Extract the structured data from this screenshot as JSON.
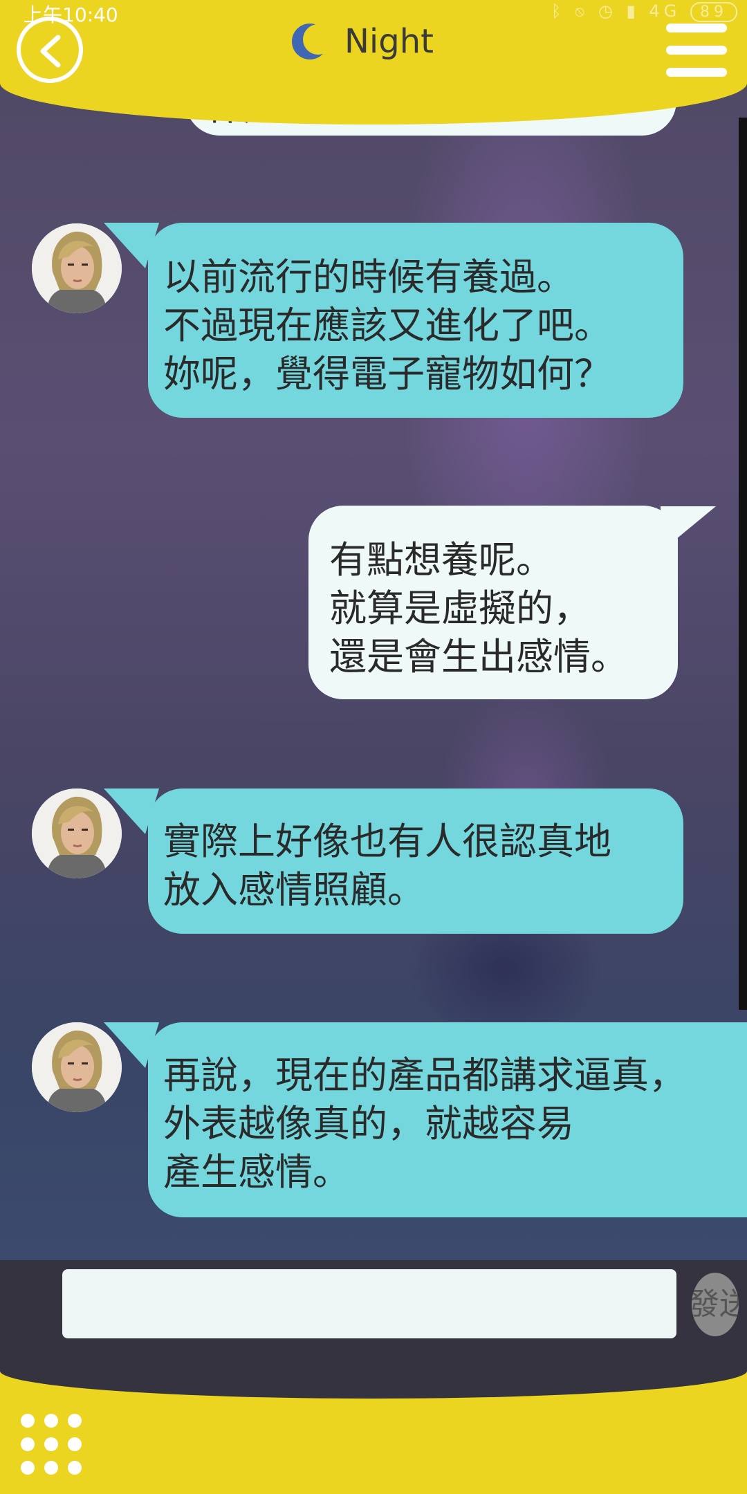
{
  "status_bar": {
    "time": "上午10:40",
    "icons": [
      "bluetooth-icon",
      "mute-icon",
      "alarm-icon",
      "signal-icon"
    ],
    "network": "4G",
    "battery": "89"
  },
  "header": {
    "title": "Night",
    "moon_icon": "moon-icon",
    "back_icon": "chevron-left-icon",
    "menu_icon": "hamburger-menu-icon"
  },
  "messages": [
    {
      "sender": "me",
      "text": "什麼電子寵物嗎？"
    },
    {
      "sender": "partner",
      "text": "以前流行的時候有養過。\n不過現在應該又進化了吧。\n妳呢，覺得電子寵物如何？"
    },
    {
      "sender": "me",
      "text": "有點想養呢。\n就算是虛擬的，\n還是會生出感情。"
    },
    {
      "sender": "partner",
      "text": "實際上好像也有人很認真地\n放入感情照顧。"
    },
    {
      "sender": "partner",
      "text": "再說，現在的產品都講求逼真，\n外表越像真的，就越容易\n產生感情。"
    }
  ],
  "composer": {
    "input_value": "",
    "send_label": "發送"
  },
  "footer": {
    "apps_icon": "grid-dots-icon"
  },
  "colors": {
    "header_yellow": "#ecd520",
    "partner_bubble": "#74d7de",
    "my_bubble": "#eef9f8"
  }
}
